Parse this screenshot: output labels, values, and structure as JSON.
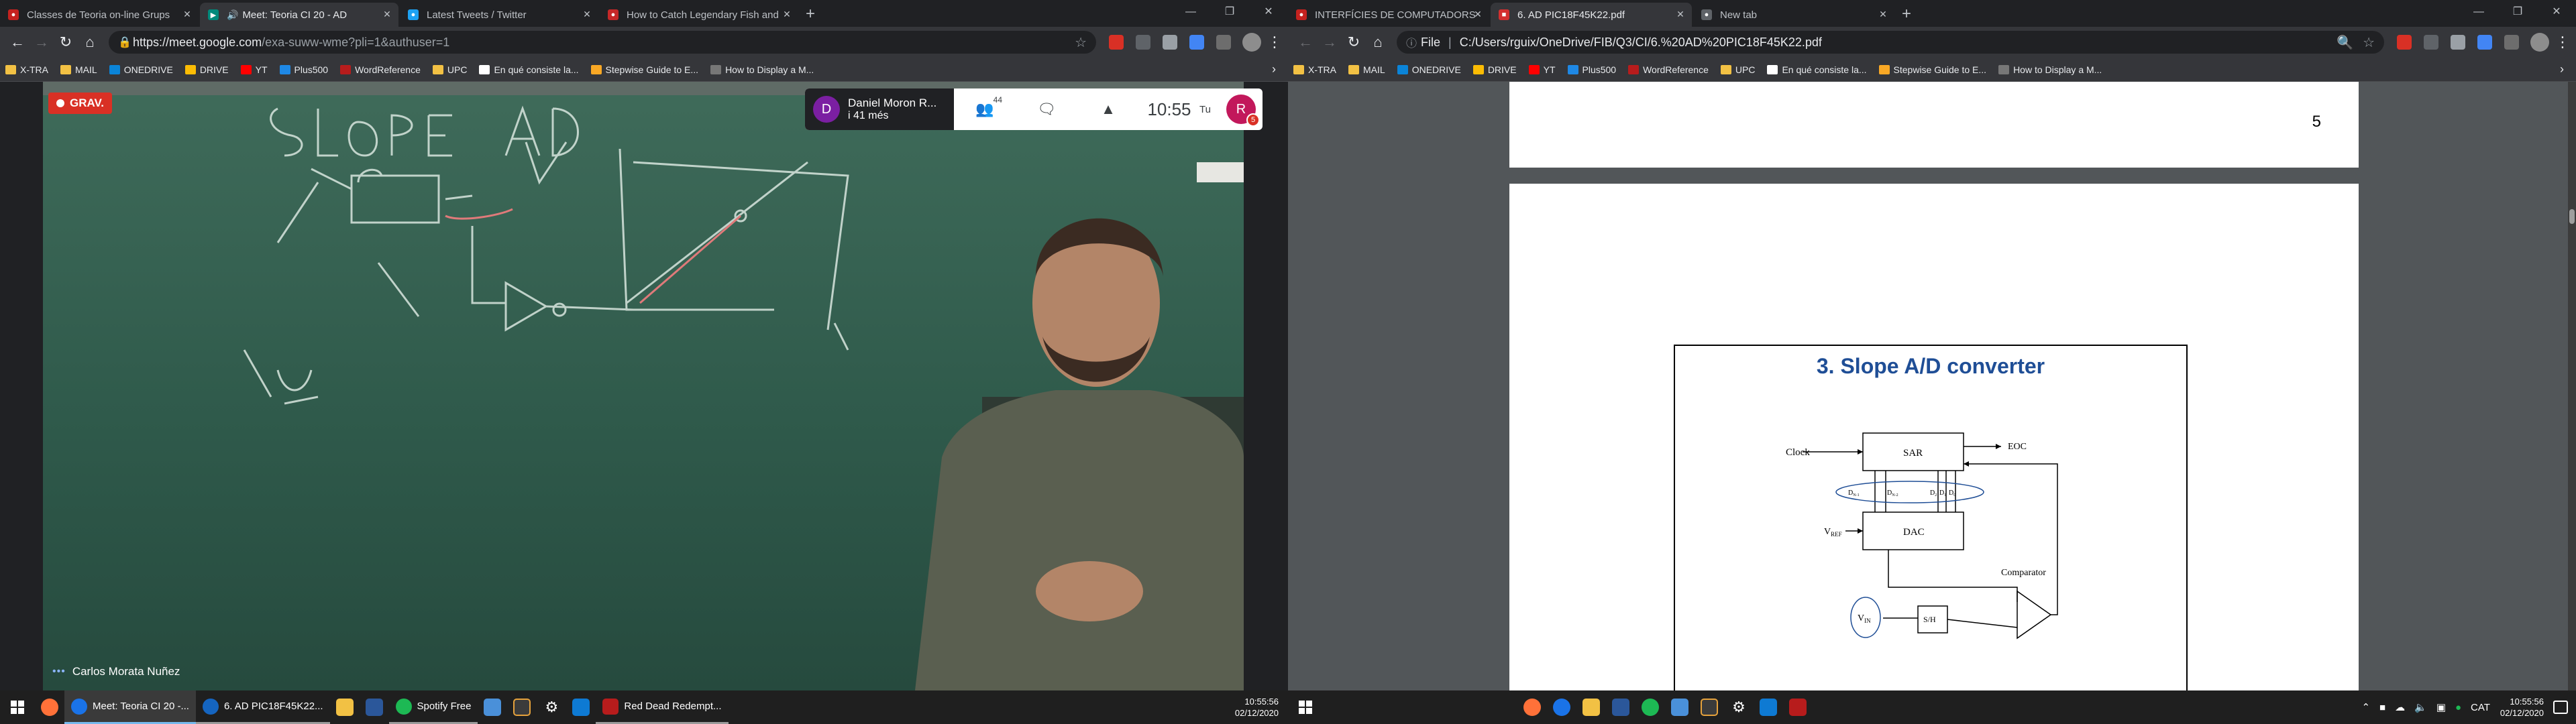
{
  "left": {
    "tabs": [
      {
        "title": "Classes de Teoria on-line Grups",
        "active": false,
        "favicon_color": "#c5221f"
      },
      {
        "title": "Meet: Teoria CI 20 - AD",
        "active": true,
        "favicon_color": "#00897b"
      },
      {
        "title": "Latest Tweets / Twitter",
        "active": false,
        "favicon_color": "#1da1f2"
      },
      {
        "title": "How to Catch Legendary Fish and",
        "active": false,
        "favicon_color": "#c62828"
      }
    ],
    "new_tab": "+",
    "url_main": "https://meet.google.com",
    "url_rest": "/exa-suww-wme?pli=1&authuser=1",
    "bookmarks": [
      "X-TRA",
      "MAIL",
      "ONEDRIVE",
      "DRIVE",
      "YT",
      "Plus500",
      "WordReference",
      "UPC",
      "En qué consiste la...",
      "Stepwise Guide to E...",
      "How to Display a M..."
    ],
    "meet": {
      "recording_label": "GRAV.",
      "presenter_initial": "D",
      "presenter_name": "Daniel Moron R...",
      "presenter_since": "i 41 més",
      "participants_count": "44",
      "time": "10:55",
      "you_label": "Tu",
      "user_initial": "R",
      "notif_count": "5",
      "speaker_name": "Carlos Morata Nuñez"
    },
    "taskbar": {
      "apps": [
        {
          "label": "Meet: Teoria CI 20 -...",
          "state": "active",
          "color": "#1a73e8"
        },
        {
          "label": "6. AD PIC18F45K22...",
          "state": "open",
          "color": "#1565c0"
        },
        {
          "label": "Spotify Free",
          "state": "open",
          "color": "#1db954"
        },
        {
          "label": "Red Dead Redempt...",
          "state": "open",
          "color": "#b71c1c"
        }
      ],
      "clock_time": "10:55:56",
      "clock_date": "02/12/2020"
    }
  },
  "right": {
    "tabs": [
      {
        "title": "INTERFÍCIES DE COMPUTADORS",
        "active": false,
        "favicon_color": "#c5221f"
      },
      {
        "title": "6. AD PIC18F45K22.pdf",
        "active": true,
        "favicon_color": "#d32f2f"
      },
      {
        "title": "New tab",
        "active": false,
        "favicon_color": "#5f6368"
      }
    ],
    "new_tab": "+",
    "file_label": "File",
    "url": "C:/Users/rguix/OneDrive/FIB/Q3/CI/6.%20AD%20PIC18F45K22.pdf",
    "bookmarks": [
      "X-TRA",
      "MAIL",
      "ONEDRIVE",
      "DRIVE",
      "YT",
      "Plus500",
      "WordReference",
      "UPC",
      "En qué consiste la...",
      "Stepwise Guide to E...",
      "How to Display a M..."
    ],
    "pdf": {
      "page_number": "5",
      "slide_title": "3. Slope A/D converter",
      "diagram": {
        "clock": "Clock",
        "sar": "SAR",
        "eoc": "EOC",
        "bits": [
          "D",
          "D",
          "D",
          "D",
          "D"
        ],
        "bit_subs": [
          "N-1",
          "N-2",
          "2",
          "1",
          "0"
        ],
        "vref": "V",
        "vref_sub": "REF",
        "dac": "DAC",
        "comparator": "Comparator",
        "vin": "V",
        "vin_sub": "IN",
        "sh": "S/H"
      }
    },
    "taskbar": {
      "lang": "CAT",
      "clock_time": "10:55:56",
      "clock_date": "02/12/2020"
    }
  }
}
